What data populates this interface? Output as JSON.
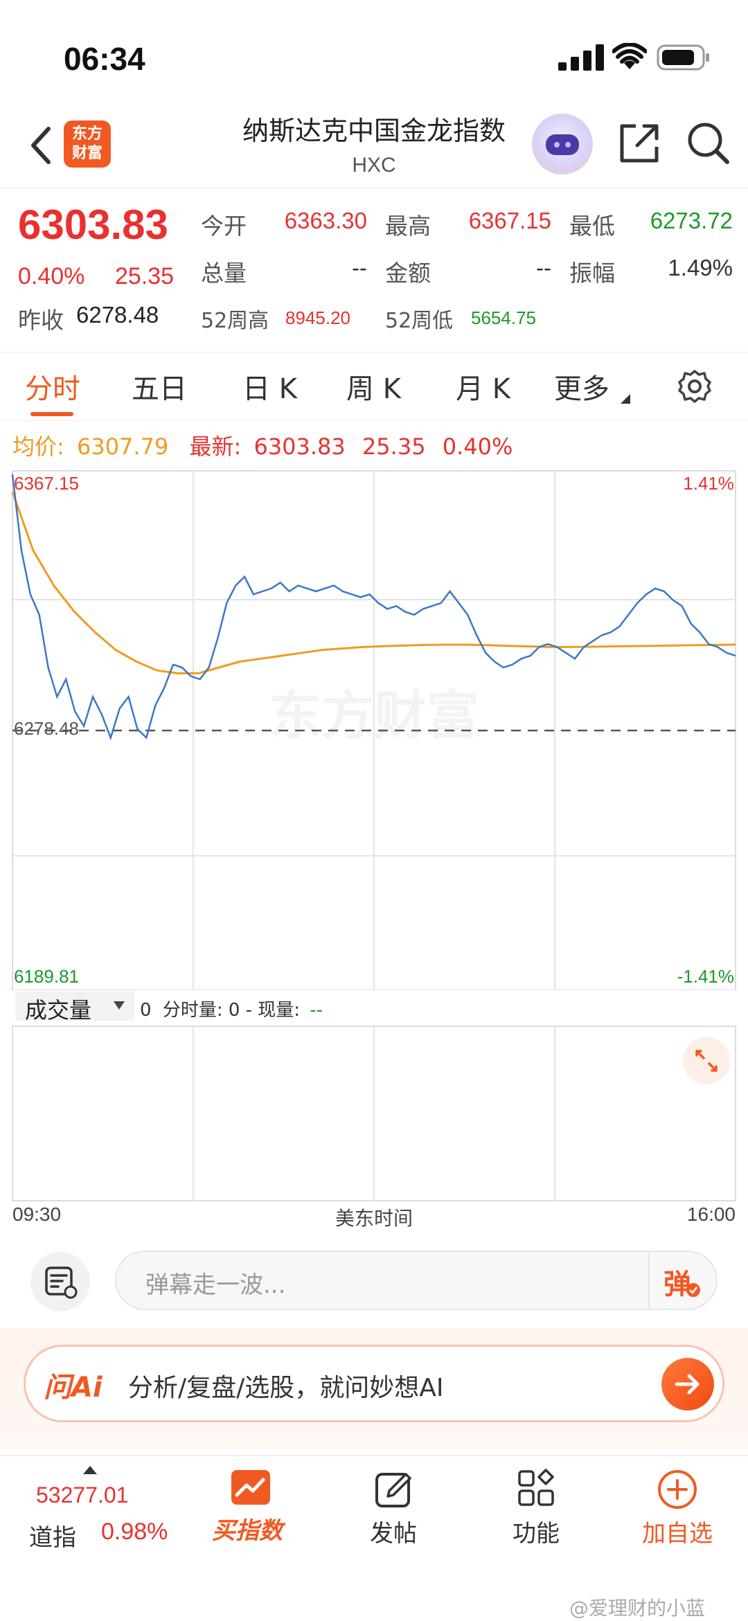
{
  "status_bar": {
    "time": "06:34"
  },
  "header": {
    "logo_line1": "东方",
    "logo_line2": "财富",
    "title": "纳斯达克中国金龙指数",
    "subtitle": "HXC",
    "back_icon": "chevron-left-icon",
    "share_icon": "share-icon",
    "search_icon": "search-icon"
  },
  "quote": {
    "price": "6303.83",
    "change_pct": "0.40%",
    "change": "25.35",
    "open_label": "今开",
    "open": "6363.30",
    "high_label": "最高",
    "high": "6367.15",
    "low_label": "最低",
    "low": "6273.72",
    "volume_label": "总量",
    "volume": "--",
    "amount_label": "金额",
    "amount": "--",
    "amplitude_label": "振幅",
    "amplitude": "1.49%",
    "prev_close_label": "昨收",
    "prev_close": "6278.48",
    "w52_high_label": "52周高",
    "w52_high": "8945.20",
    "w52_low_label": "52周低",
    "w52_low": "5654.75"
  },
  "tabs": [
    {
      "label": "分时",
      "active": true
    },
    {
      "label": "五日"
    },
    {
      "label": "日 K"
    },
    {
      "label": "周 K"
    },
    {
      "label": "月 K"
    },
    {
      "label": "更多"
    }
  ],
  "info_line": {
    "avg_label": "均价:",
    "avg_value": "6307.79",
    "latest_label": "最新:",
    "latest_value": "6303.83",
    "latest_change": "25.35",
    "latest_pct": "0.40%"
  },
  "chart_labels": {
    "top_left": "6367.15",
    "top_right": "1.41%",
    "bottom_left": "6189.81",
    "bottom_right": "-1.41%",
    "baseline": "6278.48",
    "watermark": "东方财富"
  },
  "volume": {
    "selector_label": "成交量",
    "summary_prefix": "0",
    "summary_mid": "分时量: 0 - 现量:",
    "summary_now": "--",
    "time_start": "09:30",
    "time_mid": "美东时间",
    "time_end": "16:00"
  },
  "chart_data": {
    "type": "line",
    "x_range": [
      "09:30",
      "16:00"
    ],
    "ylim": [
      6189.81,
      6367.15
    ],
    "baseline": 6278.48,
    "series": [
      {
        "name": "最新",
        "color": "#3b78c4",
        "values": [
          6366.0,
          6340,
          6325,
          6318,
          6300,
          6290,
          6296,
          6285,
          6280,
          6290,
          6284,
          6276,
          6286,
          6290,
          6279,
          6276,
          6287,
          6293,
          6301,
          6300,
          6297,
          6296,
          6300,
          6310,
          6322,
          6328,
          6331,
          6325,
          6326,
          6327,
          6329,
          6326,
          6328,
          6327,
          6326,
          6327,
          6328,
          6326,
          6325,
          6324,
          6325,
          6322,
          6320,
          6321,
          6319,
          6318,
          6320,
          6321,
          6322,
          6326,
          6322,
          6318,
          6311,
          6305,
          6302,
          6300,
          6301,
          6303,
          6304,
          6307,
          6308,
          6307,
          6305,
          6303,
          6307,
          6309,
          6311,
          6312,
          6314,
          6318,
          6322,
          6325,
          6327,
          6326,
          6323,
          6321,
          6315,
          6312,
          6308,
          6307,
          6305,
          6304
        ]
      },
      {
        "name": "均价",
        "color": "#f39a1e",
        "values": [
          6360,
          6340,
          6328,
          6319,
          6312,
          6306,
          6302,
          6299,
          6298,
          6298,
          6300,
          6302,
          6303,
          6304,
          6305,
          6306,
          6306.5,
          6307,
          6307.3,
          6307.5,
          6307.7,
          6307.8,
          6307.8,
          6307.6,
          6307.4,
          6307.2,
          6307.0,
          6307.0,
          6307.1,
          6307.2,
          6307.3,
          6307.4,
          6307.5,
          6307.6,
          6307.7,
          6307.79
        ]
      }
    ],
    "right_axis": {
      "top": "1.41%",
      "bottom": "-1.41%"
    }
  },
  "comment_bar": {
    "placeholder": "弹幕走一波...",
    "danmu_button": "弹"
  },
  "ai_bar": {
    "logo": "问Ai",
    "prompt": "分析/复盘/选股，就问妙想AI"
  },
  "bottom_nav": {
    "index_value": "53277.01",
    "index_name": "道指",
    "index_pct": "0.98%",
    "buy_index": "买指数",
    "post": "发帖",
    "functions": "功能",
    "add_watch": "加自选"
  },
  "watermark": "@爱理财的小蓝",
  "colors": {
    "up": "#e8312f",
    "down": "#1a9a2a",
    "accent": "#f05a22",
    "avg_line": "#f39a1e",
    "price_line": "#3b78c4"
  }
}
